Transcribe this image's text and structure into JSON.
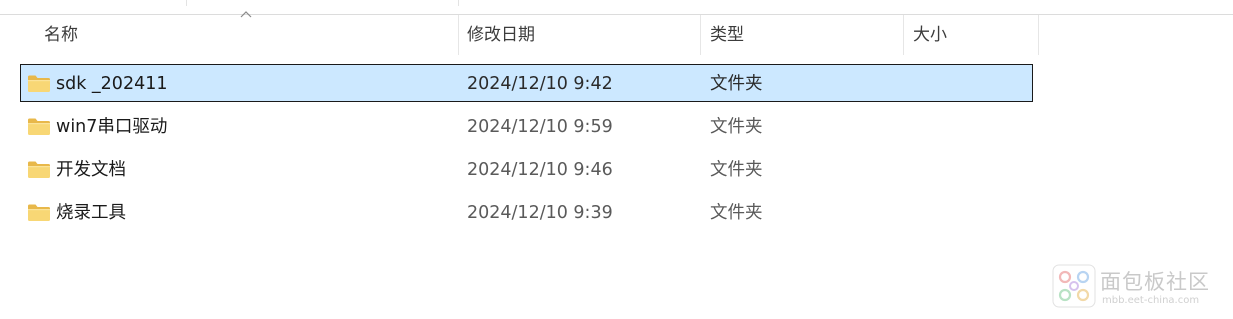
{
  "window": {
    "sort_indicator": "ascending"
  },
  "columns": {
    "name": "名称",
    "date": "修改日期",
    "type": "类型",
    "size": "大小"
  },
  "files": [
    {
      "name": "sdk _202411",
      "date": "2024/12/10 9:42",
      "type": "文件夹",
      "selected": true,
      "icon": "folder-icon"
    },
    {
      "name": "win7串口驱动",
      "date": "2024/12/10 9:59",
      "type": "文件夹",
      "selected": false,
      "icon": "folder-icon"
    },
    {
      "name": "开发文档",
      "date": "2024/12/10 9:46",
      "type": "文件夹",
      "selected": false,
      "icon": "folder-icon"
    },
    {
      "name": "烧录工具",
      "date": "2024/12/10 9:39",
      "type": "文件夹",
      "selected": false,
      "icon": "folder-icon"
    }
  ],
  "watermark": {
    "title": "面包板社区",
    "url": "mbb.eet-china.com"
  },
  "colors": {
    "selection_fill": "#cce8ff",
    "selection_border": "#1a1a1a",
    "folder_body": "#f8d775",
    "folder_tab": "#e8b84a",
    "header_text": "#3c3c3c",
    "secondary_text": "#5a5a5a"
  }
}
